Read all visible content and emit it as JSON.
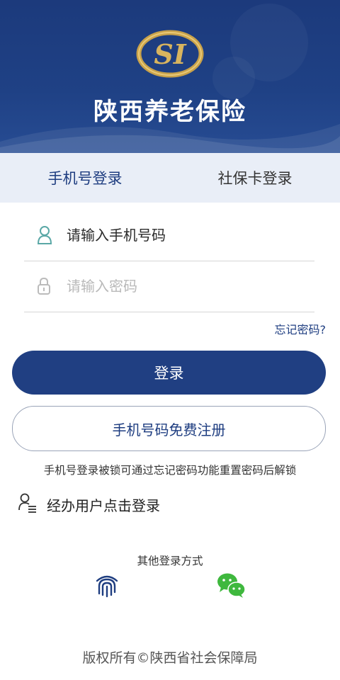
{
  "header": {
    "title": "陕西养老保险",
    "logo_text": "SI",
    "logo_icon": "social-insurance-logo"
  },
  "tabs": [
    {
      "label": "手机号登录",
      "active": true
    },
    {
      "label": "社保卡登录",
      "active": false
    }
  ],
  "form": {
    "phone_placeholder": "请输入手机号码",
    "phone_icon": "user-icon",
    "password_placeholder": "请输入密码",
    "password_icon": "lock-icon",
    "forgot_password": "忘记密码?",
    "login_button": "登录",
    "register_button": "手机号码免费注册"
  },
  "notice": "手机号登录被锁可通过忘记密码功能重置密码后解锁",
  "agent_login": {
    "label": "经办用户点击登录",
    "icon": "agent-user-icon"
  },
  "other_login": {
    "label": "其他登录方式",
    "methods": [
      {
        "name": "fingerprint",
        "icon": "fingerprint-icon"
      },
      {
        "name": "wechat",
        "icon": "wechat-icon"
      }
    ]
  },
  "footer": {
    "copyright": "版权所有©陕西省社会保障局"
  },
  "colors": {
    "primary": "#203f82",
    "header_bg": "#1f4185",
    "tab_bg": "#e9eef7",
    "logo_gold": "#c9a24a",
    "wechat_green": "#3fb83e",
    "input_icon": "#5aa8a6"
  }
}
